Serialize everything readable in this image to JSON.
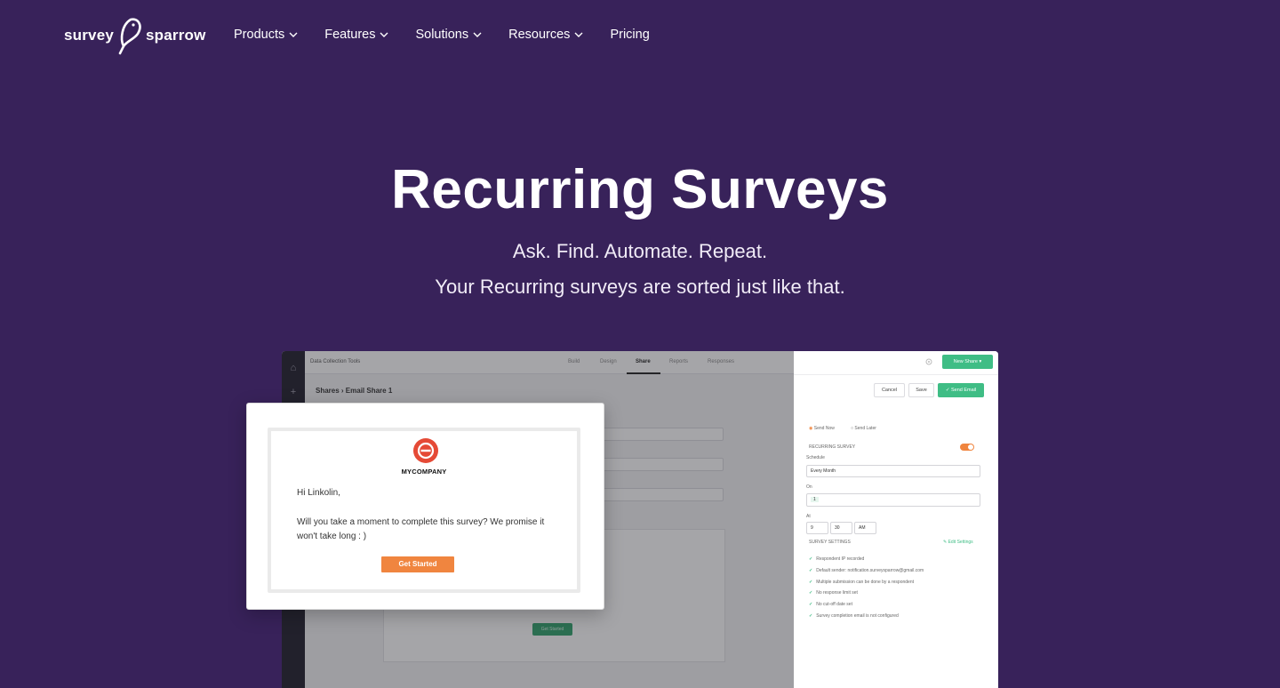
{
  "brand": {
    "logo_left": "survey",
    "logo_right": "sparrow"
  },
  "nav": {
    "items": [
      {
        "label": "Products",
        "has_dropdown": true
      },
      {
        "label": "Features",
        "has_dropdown": true
      },
      {
        "label": "Solutions",
        "has_dropdown": true
      },
      {
        "label": "Resources",
        "has_dropdown": true
      },
      {
        "label": "Pricing",
        "has_dropdown": false
      }
    ]
  },
  "hero": {
    "title": "Recurring Surveys",
    "subtitle_1": "Ask. Find. Automate. Repeat.",
    "subtitle_2": "Your Recurring surveys are sorted just like that."
  },
  "mock": {
    "project": "Data Collection Tools",
    "tabs": [
      "Build",
      "Design",
      "Share",
      "Reports",
      "Responses"
    ],
    "active_tab": "Share",
    "breadcrumb": "Shares  ›  Email Share 1",
    "body_button": "Get Started",
    "side": {
      "new_share": "New Share ▾",
      "cancel": "Cancel",
      "save": "Save",
      "send": "✓ Send Email",
      "send_now": "Send Now",
      "send_later": "Send Later",
      "recurring_label": "RECURRING SURVEY",
      "schedule_label": "Schedule",
      "schedule_value": "Every Month",
      "on_label": "On",
      "on_value": "1",
      "at_label": "At",
      "hour": "9",
      "minute": "30",
      "ampm": "AM",
      "settings_label": "SURVEY SETTINGS",
      "edit_settings": "✎ Edit Settings",
      "checks": [
        "Respondent IP recorded",
        "Default sender: notification.surveysparrow@gmail.com",
        "Multiple submission can be done by a respondent",
        "No response limit set",
        "No cut-off date set",
        "Survey completion email is not configured"
      ]
    }
  },
  "email_card": {
    "company": "MYCOMPANY",
    "greeting": "Hi Linkolin,",
    "message": "Will you take a moment to complete this survey? We promise it won't take long : )",
    "button": "Get Started"
  },
  "colors": {
    "background": "#38225a",
    "accent_orange": "#f0853f",
    "accent_green": "#3fbd85",
    "brand_red": "#e54a36"
  }
}
